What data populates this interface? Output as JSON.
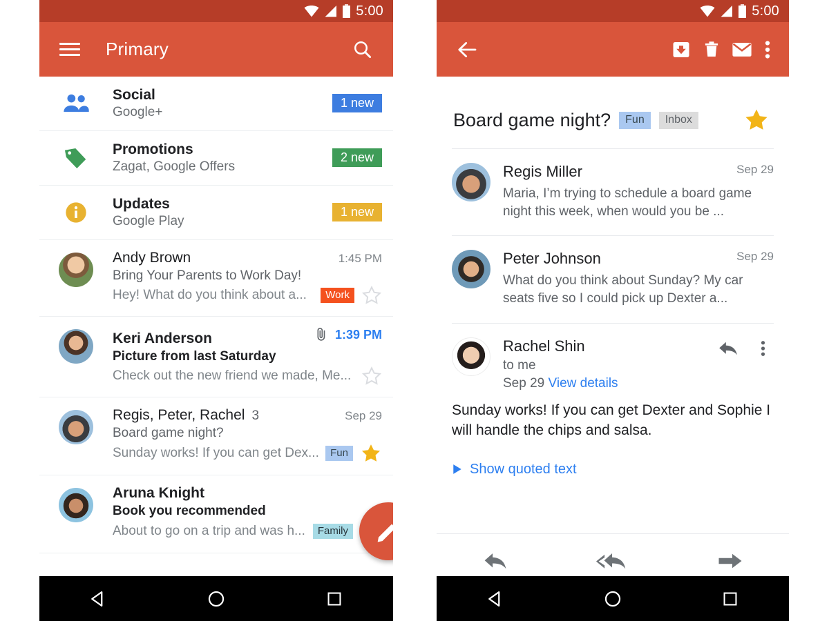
{
  "status_bar": {
    "time": "5:00",
    "icons": [
      "wifi-icon",
      "signal-icon",
      "battery-icon"
    ]
  },
  "colors": {
    "status_bar_bg": "#b63d28",
    "app_bar_bg": "#d9553b",
    "fab_bg": "#d9553b",
    "badge_blue": "#3d7de0",
    "badge_green": "#3f9c58",
    "badge_yellow": "#e8b231",
    "chip_work": "#f4511e",
    "chip_fun": "#aac8f0",
    "chip_family": "#a7dbe6",
    "star_gold": "#f2b417",
    "link_blue": "#2d7ff0"
  },
  "left_phone": {
    "app_bar": {
      "menu_icon": "hamburger-icon",
      "title": "Primary",
      "search_icon": "search-icon"
    },
    "categories": [
      {
        "icon": "people-icon",
        "title": "Social",
        "subtitle": "Google+",
        "badge": "1 new",
        "badge_color": "blue"
      },
      {
        "icon": "tag-icon",
        "title": "Promotions",
        "subtitle": "Zagat, Google Offers",
        "badge": "2 new",
        "badge_color": "green"
      },
      {
        "icon": "info-icon",
        "title": "Updates",
        "subtitle": "Google Play",
        "badge": "1 new",
        "badge_color": "yellow"
      }
    ],
    "messages": [
      {
        "sender": "Andy Brown",
        "count": "",
        "time": "1:45 PM",
        "time_style": "plain",
        "subject": "Bring Your Parents to Work Day!",
        "snippet": "Hey! What do you think about a...",
        "chip": "Work",
        "chip_style": "work",
        "unread": false,
        "starred": false,
        "attachment": false
      },
      {
        "sender": "Keri Anderson",
        "count": "",
        "time": "1:39 PM",
        "time_style": "blue",
        "subject": "Picture from last Saturday",
        "snippet": "Check out the new friend we made, Me...",
        "chip": "",
        "chip_style": "",
        "unread": true,
        "starred": false,
        "attachment": true
      },
      {
        "sender": "Regis, Peter, Rachel",
        "count": "3",
        "time": "Sep 29",
        "time_style": "plain",
        "subject": "Board game night?",
        "snippet": "Sunday works! If you can get Dex...",
        "chip": "Fun",
        "chip_style": "fun",
        "unread": false,
        "starred": true,
        "attachment": false
      },
      {
        "sender": "Aruna Knight",
        "count": "",
        "time": "",
        "time_style": "plain",
        "subject": "Book you recommended",
        "snippet": "About to go on a trip and was h...",
        "chip": "Family",
        "chip_style": "family",
        "unread": true,
        "starred": true,
        "attachment": false
      }
    ],
    "fab": {
      "icon": "compose-pencil-icon"
    },
    "nav_bar": {
      "back": "back-triangle-icon",
      "home": "home-circle-icon",
      "recents": "recents-square-icon"
    }
  },
  "right_phone": {
    "app_bar": {
      "back_icon": "back-arrow-icon",
      "archive_icon": "archive-icon",
      "delete_icon": "trash-icon",
      "mail_icon": "mark-unread-icon",
      "overflow_icon": "overflow-menu-icon"
    },
    "thread": {
      "subject": "Board game night?",
      "labels": [
        {
          "text": "Fun",
          "style": "fun"
        },
        {
          "text": "Inbox",
          "style": "inbox"
        }
      ],
      "starred": true,
      "messages": [
        {
          "type": "collapsed",
          "name": "Regis Miller",
          "date": "Sep 29",
          "snippet": "Maria, I’m trying to schedule a board game night this week, when would you be ..."
        },
        {
          "type": "collapsed",
          "name": "Peter Johnson",
          "date": "Sep 29",
          "snippet": "What do you think about Sunday? My car seats five so I could pick up Dexter a..."
        },
        {
          "type": "expanded",
          "name": "Rachel Shin",
          "recipient": "to me",
          "date": "Sep 29",
          "details_link": "View details",
          "body": "Sunday works! If you can get Dexter and Sophie I will handle the chips and salsa.",
          "quoted_text_label": "Show quoted text",
          "reply_icon": "reply-icon",
          "overflow_icon": "overflow-menu-icon"
        }
      ]
    },
    "reply_bar": {
      "reply_icon": "reply-icon",
      "reply_all_icon": "reply-all-icon",
      "forward_icon": "forward-icon"
    },
    "nav_bar": {
      "back": "back-triangle-icon",
      "home": "home-circle-icon",
      "recents": "recents-square-icon"
    }
  }
}
